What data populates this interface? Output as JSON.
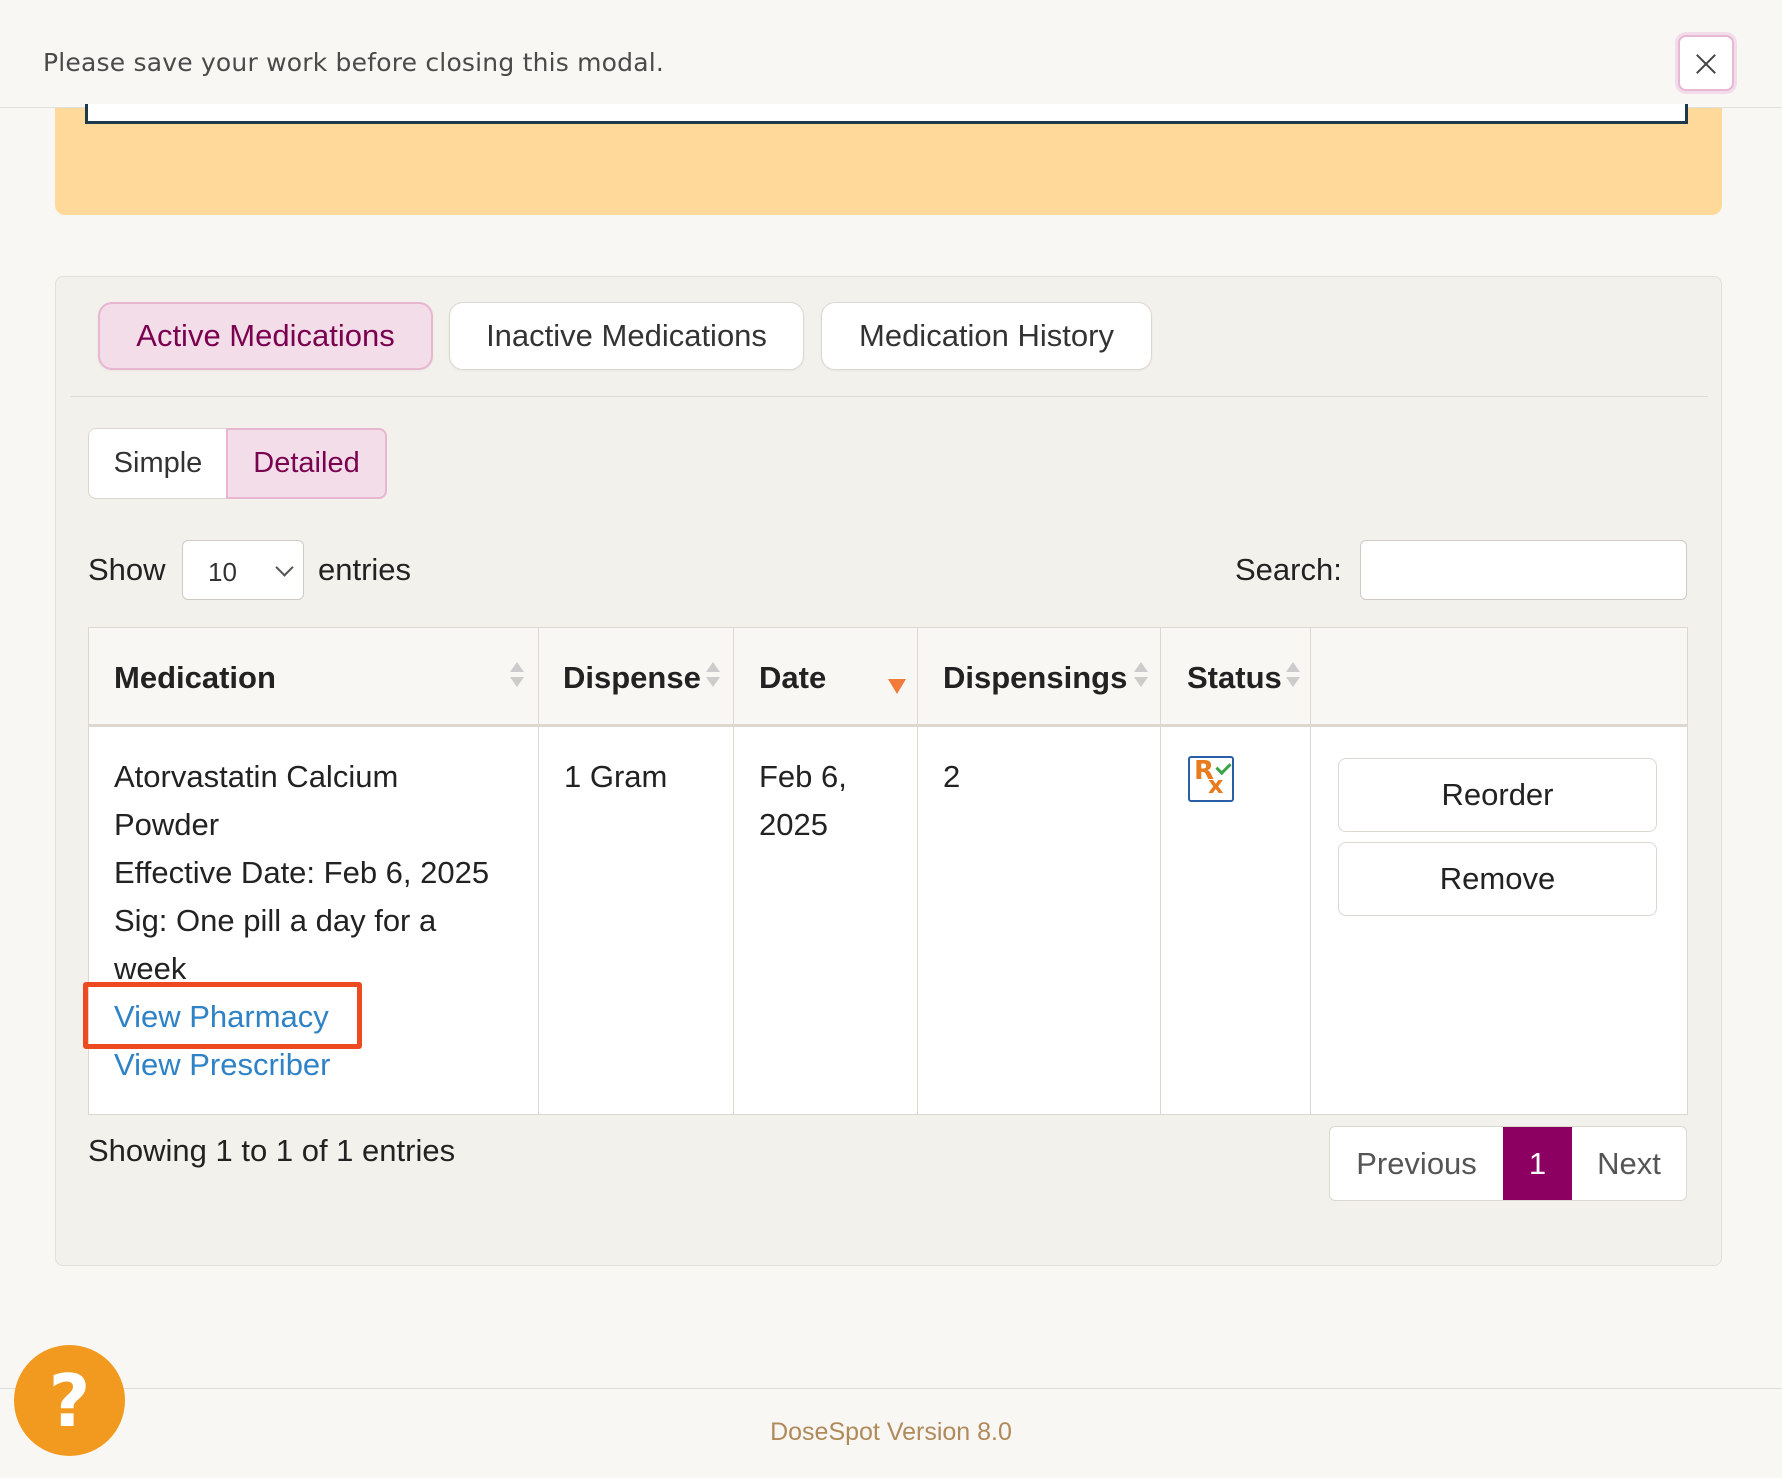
{
  "modal": {
    "warning": "Please save your work before closing this modal.",
    "close_icon": "close-icon"
  },
  "tabs": [
    {
      "label": "Active Medications",
      "active": true
    },
    {
      "label": "Inactive Medications",
      "active": false
    },
    {
      "label": "Medication History",
      "active": false
    }
  ],
  "view_toggle": {
    "simple": "Simple",
    "detailed": "Detailed",
    "selected": "Detailed"
  },
  "length": {
    "show": "Show",
    "value": "10",
    "entries": "entries"
  },
  "search": {
    "label": "Search:",
    "value": ""
  },
  "table": {
    "headers": [
      "Medication",
      "Dispense",
      "Date",
      "Dispensings",
      "Status"
    ],
    "sorted_column": "Date",
    "sort_direction": "desc",
    "rows": [
      {
        "medication_line1": "Atorvastatin Calcium",
        "medication_line2": "Powder",
        "effective_date": "Effective Date: Feb 6, 2025",
        "sig_line1": "Sig: One pill a day for a",
        "sig_line2": "week",
        "view_pharmacy": "View Pharmacy",
        "view_prescriber": "View Prescriber",
        "dispense": "1 Gram",
        "date_line1": "Feb 6,",
        "date_line2": "2025",
        "dispensings": "2",
        "status_icon": "rx-check-icon",
        "reorder": "Reorder",
        "remove": "Remove"
      }
    ]
  },
  "info": "Showing 1 to 1 of 1 entries",
  "pagination": {
    "previous": "Previous",
    "current": "1",
    "next": "Next"
  },
  "help": {
    "label": "?"
  },
  "footer": {
    "version": "DoseSpot Version 8.0"
  },
  "colors": {
    "accent": "#8b0061",
    "warning_panel": "#fed99a",
    "link": "#2f82c5",
    "help_button": "#f29a1f",
    "highlight_box": "#ee4a22"
  }
}
